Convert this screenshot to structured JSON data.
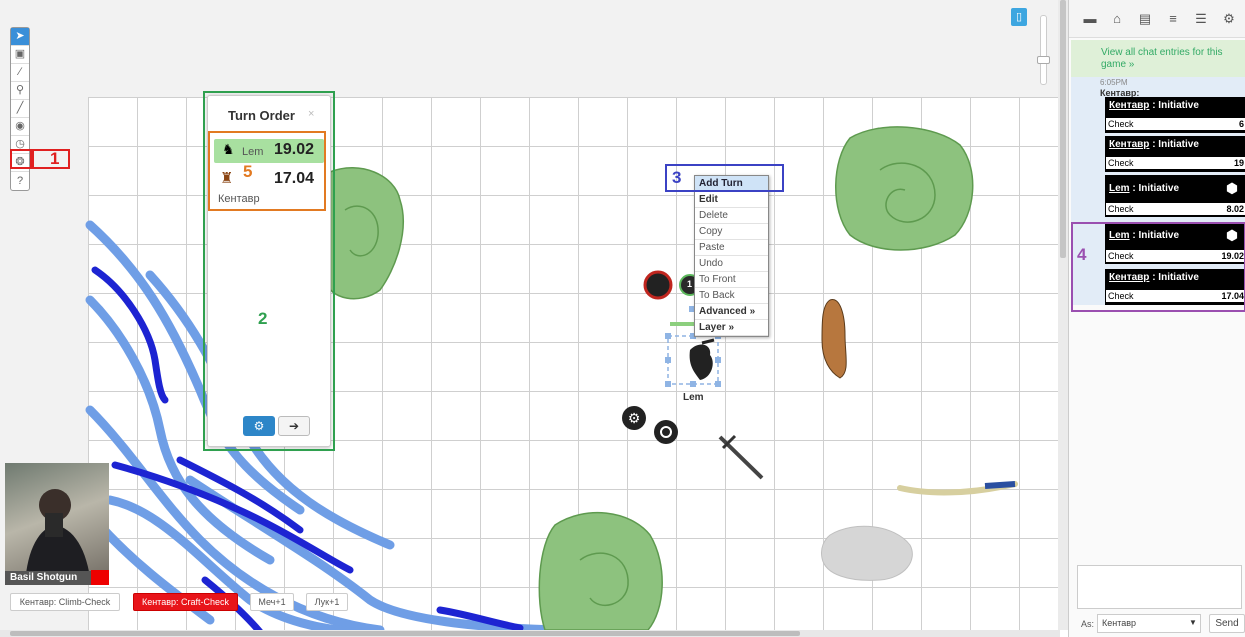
{
  "colors": {
    "accent": "#2d86c8",
    "annotation_red": "#e02020",
    "annotation_green": "#2fa04f",
    "annotation_blue": "#3b42c4",
    "annotation_purple": "#9a4fb0",
    "annotation_orange": "#e27a22",
    "turn_highlight": "#a8e0a0",
    "chat_bg": "#e2ecf7"
  },
  "annotations": {
    "n1": "1",
    "n2": "2",
    "n3": "3",
    "n4": "4",
    "n5": "5"
  },
  "toolbar": {
    "tools": [
      "select-icon",
      "cube-icon",
      "brush-icon",
      "zoom-icon",
      "ruler-icon",
      "eye-icon",
      "clock-icon",
      "token-icon",
      "help-icon"
    ]
  },
  "turn_order": {
    "title": "Turn Order",
    "close": "×",
    "entries": [
      {
        "name": "Lem",
        "value": "19.02"
      },
      {
        "name": "Кентавр",
        "value": "17.04"
      }
    ]
  },
  "context_menu": {
    "items": [
      "Add Turn",
      "Edit",
      "Delete",
      "Copy",
      "Paste",
      "Undo",
      "To Front",
      "To Back",
      "Advanced »",
      "Layer »"
    ]
  },
  "tokens": {
    "lem_label": "Lem",
    "token_badge": "1"
  },
  "webcam": {
    "name": "Basil Shotgun"
  },
  "macros": [
    "Кентавр: Climb-Check",
    "Кентавр: Craft-Check",
    "Меч+1",
    "Лук+1"
  ],
  "chat": {
    "view_all": "View all chat entries for this game »",
    "time": "6:05PM",
    "speaker": "Кентавр:",
    "rolls": [
      {
        "name": "Кентавр",
        "label": " : Initiative",
        "check": "Check",
        "value": "6"
      },
      {
        "name": "Кентавр",
        "label": " : Initiative",
        "check": "Check",
        "value": "19"
      },
      {
        "name": "Lem",
        "label": " : Initiative",
        "check": "Check",
        "value": "8.02"
      },
      {
        "name": "Lem",
        "label": " : Initiative",
        "check": "Check",
        "value": "19.02"
      },
      {
        "name": "Кентавр",
        "label": " : Initiative",
        "check": "Check",
        "value": "17.04"
      }
    ],
    "as_label": "As:",
    "as_value": "Кентавр",
    "send_label": "Send"
  }
}
